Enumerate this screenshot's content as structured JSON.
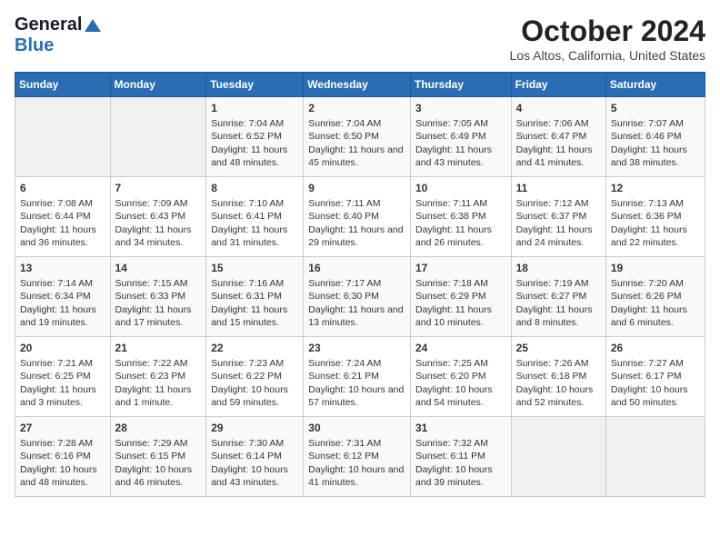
{
  "header": {
    "logo_general": "General",
    "logo_blue": "Blue",
    "month_title": "October 2024",
    "location": "Los Altos, California, United States"
  },
  "days_of_week": [
    "Sunday",
    "Monday",
    "Tuesday",
    "Wednesday",
    "Thursday",
    "Friday",
    "Saturday"
  ],
  "weeks": [
    [
      {
        "day": "",
        "sunrise": "",
        "sunset": "",
        "daylight": ""
      },
      {
        "day": "",
        "sunrise": "",
        "sunset": "",
        "daylight": ""
      },
      {
        "day": "1",
        "sunrise": "Sunrise: 7:04 AM",
        "sunset": "Sunset: 6:52 PM",
        "daylight": "Daylight: 11 hours and 48 minutes."
      },
      {
        "day": "2",
        "sunrise": "Sunrise: 7:04 AM",
        "sunset": "Sunset: 6:50 PM",
        "daylight": "Daylight: 11 hours and 45 minutes."
      },
      {
        "day": "3",
        "sunrise": "Sunrise: 7:05 AM",
        "sunset": "Sunset: 6:49 PM",
        "daylight": "Daylight: 11 hours and 43 minutes."
      },
      {
        "day": "4",
        "sunrise": "Sunrise: 7:06 AM",
        "sunset": "Sunset: 6:47 PM",
        "daylight": "Daylight: 11 hours and 41 minutes."
      },
      {
        "day": "5",
        "sunrise": "Sunrise: 7:07 AM",
        "sunset": "Sunset: 6:46 PM",
        "daylight": "Daylight: 11 hours and 38 minutes."
      }
    ],
    [
      {
        "day": "6",
        "sunrise": "Sunrise: 7:08 AM",
        "sunset": "Sunset: 6:44 PM",
        "daylight": "Daylight: 11 hours and 36 minutes."
      },
      {
        "day": "7",
        "sunrise": "Sunrise: 7:09 AM",
        "sunset": "Sunset: 6:43 PM",
        "daylight": "Daylight: 11 hours and 34 minutes."
      },
      {
        "day": "8",
        "sunrise": "Sunrise: 7:10 AM",
        "sunset": "Sunset: 6:41 PM",
        "daylight": "Daylight: 11 hours and 31 minutes."
      },
      {
        "day": "9",
        "sunrise": "Sunrise: 7:11 AM",
        "sunset": "Sunset: 6:40 PM",
        "daylight": "Daylight: 11 hours and 29 minutes."
      },
      {
        "day": "10",
        "sunrise": "Sunrise: 7:11 AM",
        "sunset": "Sunset: 6:38 PM",
        "daylight": "Daylight: 11 hours and 26 minutes."
      },
      {
        "day": "11",
        "sunrise": "Sunrise: 7:12 AM",
        "sunset": "Sunset: 6:37 PM",
        "daylight": "Daylight: 11 hours and 24 minutes."
      },
      {
        "day": "12",
        "sunrise": "Sunrise: 7:13 AM",
        "sunset": "Sunset: 6:36 PM",
        "daylight": "Daylight: 11 hours and 22 minutes."
      }
    ],
    [
      {
        "day": "13",
        "sunrise": "Sunrise: 7:14 AM",
        "sunset": "Sunset: 6:34 PM",
        "daylight": "Daylight: 11 hours and 19 minutes."
      },
      {
        "day": "14",
        "sunrise": "Sunrise: 7:15 AM",
        "sunset": "Sunset: 6:33 PM",
        "daylight": "Daylight: 11 hours and 17 minutes."
      },
      {
        "day": "15",
        "sunrise": "Sunrise: 7:16 AM",
        "sunset": "Sunset: 6:31 PM",
        "daylight": "Daylight: 11 hours and 15 minutes."
      },
      {
        "day": "16",
        "sunrise": "Sunrise: 7:17 AM",
        "sunset": "Sunset: 6:30 PM",
        "daylight": "Daylight: 11 hours and 13 minutes."
      },
      {
        "day": "17",
        "sunrise": "Sunrise: 7:18 AM",
        "sunset": "Sunset: 6:29 PM",
        "daylight": "Daylight: 11 hours and 10 minutes."
      },
      {
        "day": "18",
        "sunrise": "Sunrise: 7:19 AM",
        "sunset": "Sunset: 6:27 PM",
        "daylight": "Daylight: 11 hours and 8 minutes."
      },
      {
        "day": "19",
        "sunrise": "Sunrise: 7:20 AM",
        "sunset": "Sunset: 6:26 PM",
        "daylight": "Daylight: 11 hours and 6 minutes."
      }
    ],
    [
      {
        "day": "20",
        "sunrise": "Sunrise: 7:21 AM",
        "sunset": "Sunset: 6:25 PM",
        "daylight": "Daylight: 11 hours and 3 minutes."
      },
      {
        "day": "21",
        "sunrise": "Sunrise: 7:22 AM",
        "sunset": "Sunset: 6:23 PM",
        "daylight": "Daylight: 11 hours and 1 minute."
      },
      {
        "day": "22",
        "sunrise": "Sunrise: 7:23 AM",
        "sunset": "Sunset: 6:22 PM",
        "daylight": "Daylight: 10 hours and 59 minutes."
      },
      {
        "day": "23",
        "sunrise": "Sunrise: 7:24 AM",
        "sunset": "Sunset: 6:21 PM",
        "daylight": "Daylight: 10 hours and 57 minutes."
      },
      {
        "day": "24",
        "sunrise": "Sunrise: 7:25 AM",
        "sunset": "Sunset: 6:20 PM",
        "daylight": "Daylight: 10 hours and 54 minutes."
      },
      {
        "day": "25",
        "sunrise": "Sunrise: 7:26 AM",
        "sunset": "Sunset: 6:18 PM",
        "daylight": "Daylight: 10 hours and 52 minutes."
      },
      {
        "day": "26",
        "sunrise": "Sunrise: 7:27 AM",
        "sunset": "Sunset: 6:17 PM",
        "daylight": "Daylight: 10 hours and 50 minutes."
      }
    ],
    [
      {
        "day": "27",
        "sunrise": "Sunrise: 7:28 AM",
        "sunset": "Sunset: 6:16 PM",
        "daylight": "Daylight: 10 hours and 48 minutes."
      },
      {
        "day": "28",
        "sunrise": "Sunrise: 7:29 AM",
        "sunset": "Sunset: 6:15 PM",
        "daylight": "Daylight: 10 hours and 46 minutes."
      },
      {
        "day": "29",
        "sunrise": "Sunrise: 7:30 AM",
        "sunset": "Sunset: 6:14 PM",
        "daylight": "Daylight: 10 hours and 43 minutes."
      },
      {
        "day": "30",
        "sunrise": "Sunrise: 7:31 AM",
        "sunset": "Sunset: 6:12 PM",
        "daylight": "Daylight: 10 hours and 41 minutes."
      },
      {
        "day": "31",
        "sunrise": "Sunrise: 7:32 AM",
        "sunset": "Sunset: 6:11 PM",
        "daylight": "Daylight: 10 hours and 39 minutes."
      },
      {
        "day": "",
        "sunrise": "",
        "sunset": "",
        "daylight": ""
      },
      {
        "day": "",
        "sunrise": "",
        "sunset": "",
        "daylight": ""
      }
    ]
  ]
}
